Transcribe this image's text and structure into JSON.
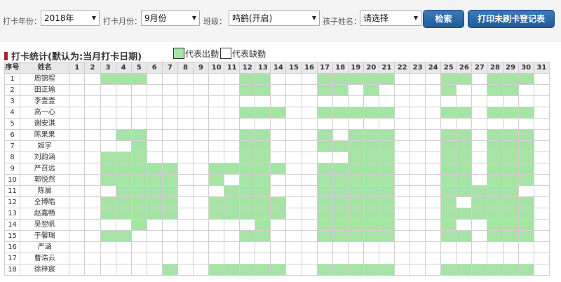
{
  "filters": {
    "year_label": "打卡年份：",
    "year_value": "2018年",
    "month_label": "打卡月份：",
    "month_value": "9月份",
    "class_label": "班级：",
    "class_value": "鸣鹤(开启)",
    "child_label": "孩子姓名：",
    "child_value": "请选择",
    "search_button": "检索",
    "print_button": "打印未刷卡登记表"
  },
  "section": {
    "title": "打卡统计(默认为:当月打卡日期)",
    "legend_present": "代表出勤",
    "legend_absent": "代表缺勤"
  },
  "colors": {
    "present": "#a6e4a6",
    "absent": "#ffffff",
    "button": "#2a67a8",
    "title_mark": "#a02828"
  },
  "table": {
    "headers": [
      "序号",
      "姓名"
    ],
    "days": [
      "1",
      "2",
      "3",
      "4",
      "5",
      "6",
      "7",
      "8",
      "9",
      "10",
      "11",
      "12",
      "13",
      "14",
      "15",
      "16",
      "17",
      "18",
      "19",
      "20",
      "21",
      "22",
      "23",
      "24",
      "25",
      "26",
      "27",
      "28",
      "29",
      "30",
      "31"
    ],
    "rows": [
      {
        "no": "1",
        "name": "周锦程",
        "present": [
          3,
          4,
          5,
          12,
          13,
          17,
          18,
          19,
          20,
          21,
          25,
          26,
          28,
          29,
          30
        ]
      },
      {
        "no": "2",
        "name": "田正瑜",
        "present": [
          12,
          13,
          17,
          18,
          20,
          25,
          28,
          29
        ]
      },
      {
        "no": "3",
        "name": "李壹壹",
        "present": []
      },
      {
        "no": "4",
        "name": "高一心",
        "present": [
          12,
          13,
          14,
          17,
          18,
          19,
          20,
          21,
          25,
          26,
          28,
          29,
          30
        ]
      },
      {
        "no": "5",
        "name": "谢安淇",
        "present": []
      },
      {
        "no": "6",
        "name": "陈果果",
        "present": [
          4,
          5,
          12,
          13,
          17,
          19,
          20,
          21,
          25,
          26,
          28,
          29,
          30
        ]
      },
      {
        "no": "7",
        "name": "姬宇",
        "present": [
          5,
          12,
          13,
          17,
          18,
          19,
          20,
          21,
          25,
          26,
          28,
          29,
          30
        ]
      },
      {
        "no": "8",
        "name": "刘韵涵",
        "present": [
          3,
          4,
          5,
          12,
          13,
          19,
          20,
          21,
          25,
          26,
          28,
          29,
          30
        ]
      },
      {
        "no": "9",
        "name": "严召远",
        "present": [
          3,
          4,
          5,
          6,
          7,
          10,
          11,
          12,
          13,
          14,
          17,
          18,
          19,
          20,
          21,
          25,
          26,
          28,
          29,
          30
        ]
      },
      {
        "no": "10",
        "name": "郭悦然",
        "present": [
          3,
          4,
          5,
          6,
          7,
          10,
          12,
          13,
          17,
          18,
          19,
          20,
          21,
          25,
          26,
          28,
          29,
          30
        ]
      },
      {
        "no": "11",
        "name": "陈晨",
        "present": [
          4,
          5,
          6,
          7,
          11,
          12,
          13,
          17,
          18,
          19,
          20,
          21,
          25,
          26,
          27,
          28,
          29
        ]
      },
      {
        "no": "12",
        "name": "仝博皓",
        "present": [
          3,
          4,
          5,
          6,
          7,
          10,
          11,
          12,
          13,
          14,
          17,
          18,
          19,
          20,
          21,
          25,
          27,
          28,
          29,
          30
        ]
      },
      {
        "no": "13",
        "name": "赵嘉畅",
        "present": [
          3,
          4,
          5,
          6,
          7,
          10,
          11,
          12,
          13,
          14,
          17,
          18,
          19,
          20,
          21,
          25,
          26,
          27,
          28,
          29,
          30
        ]
      },
      {
        "no": "14",
        "name": "吴翌帆",
        "present": [
          5,
          13,
          17,
          18,
          19,
          20,
          21,
          25,
          28,
          29,
          30
        ]
      },
      {
        "no": "15",
        "name": "于馨瑞",
        "present": [
          3,
          4,
          12,
          13,
          17,
          18,
          19,
          20,
          21,
          25,
          26,
          28,
          29,
          30
        ]
      },
      {
        "no": "16",
        "name": "严涵",
        "present": []
      },
      {
        "no": "17",
        "name": "曹浩云",
        "present": []
      },
      {
        "no": "18",
        "name": "徐梓宸",
        "present": [
          7,
          10,
          11,
          12,
          13,
          14,
          17,
          18,
          19,
          20,
          21,
          25,
          26,
          27,
          28,
          29,
          30
        ]
      }
    ]
  }
}
